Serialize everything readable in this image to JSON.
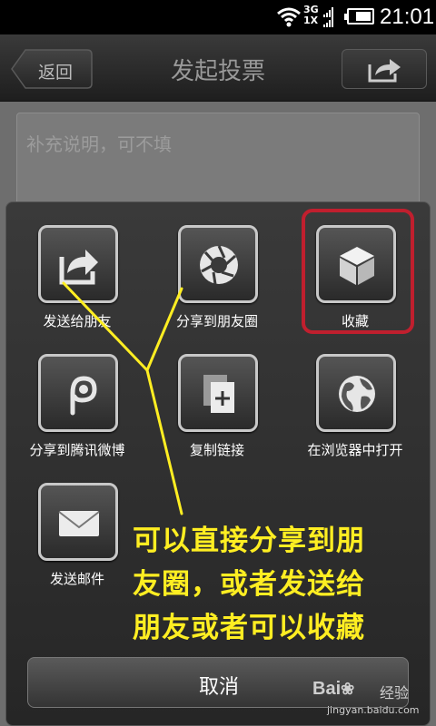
{
  "status_bar": {
    "network_top": "3G",
    "network_bottom": "1X",
    "time": "21:01"
  },
  "title_bar": {
    "back_label": "返回",
    "title": "发起投票",
    "share_icon": "share-icon"
  },
  "form": {
    "note_placeholder": "补充说明，可不填"
  },
  "share_sheet": {
    "items": [
      {
        "label": "发送给朋友",
        "icon": "share-arrow-icon"
      },
      {
        "label": "分享到朋友圈",
        "icon": "aperture-icon"
      },
      {
        "label": "收藏",
        "icon": "cube-icon"
      },
      {
        "label": "分享到腾讯微博",
        "icon": "tencent-weibo-icon"
      },
      {
        "label": "复制链接",
        "icon": "copy-link-icon"
      },
      {
        "label": "在浏览器中打开",
        "icon": "globe-icon"
      },
      {
        "label": "发送邮件",
        "icon": "envelope-icon"
      }
    ],
    "cancel_label": "取消"
  },
  "annotation": {
    "lines": [
      "可以直接分享到朋",
      "友圈，或者发送给",
      "朋友或者可以收藏"
    ],
    "color": "#ffee22",
    "highlight_color": "#c01f2e"
  },
  "watermark": {
    "logo": "Bai",
    "brand": "经验",
    "site": "jingyan.baidu.com"
  }
}
